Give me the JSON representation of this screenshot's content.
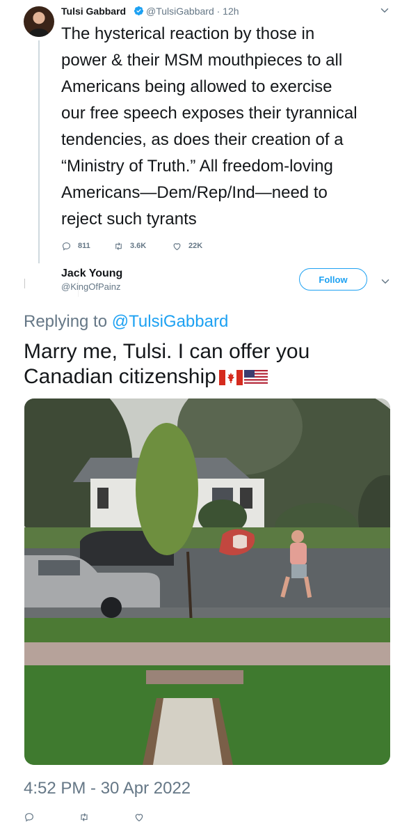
{
  "parent_tweet": {
    "author_name": "Tulsi Gabbard",
    "author_handle": "@TulsiGabbard · 12h",
    "text": "The hysterical reaction by those in\npower & their MSM mouthpieces to all\nAmericans being allowed to exercise\nour free speech exposes their tyrannical\ntendencies, as does their creation of a\n“Ministry of Truth.” All freedom-loving\nAmericans—Dem/Rep/Ind—need to\nreject such tyrants",
    "replies": "811",
    "retweets": "3.6K",
    "likes": "22K",
    "icons": [
      "verified-icon",
      "chevron-down-icon",
      "reply-icon",
      "retweet-icon",
      "like-icon"
    ]
  },
  "reply_tweet": {
    "author_name": "Jack Young",
    "author_handle": "@KingOfPainz",
    "follow_label": "Follow",
    "replying_prefix": "Replying to ",
    "replying_mention": "@TulsiGabbard",
    "text": "Marry me, Tulsi. I can offer you Canadian citizenship",
    "timestamp": "4:52 PM - 30 Apr 2022",
    "icons": [
      "canada-flag-icon",
      "us-flag-icon",
      "reply-icon",
      "retweet-icon",
      "like-icon"
    ]
  },
  "colors": {
    "accent": "#1da1f2",
    "secondary_text": "#657786",
    "primary_text": "#14171a"
  }
}
